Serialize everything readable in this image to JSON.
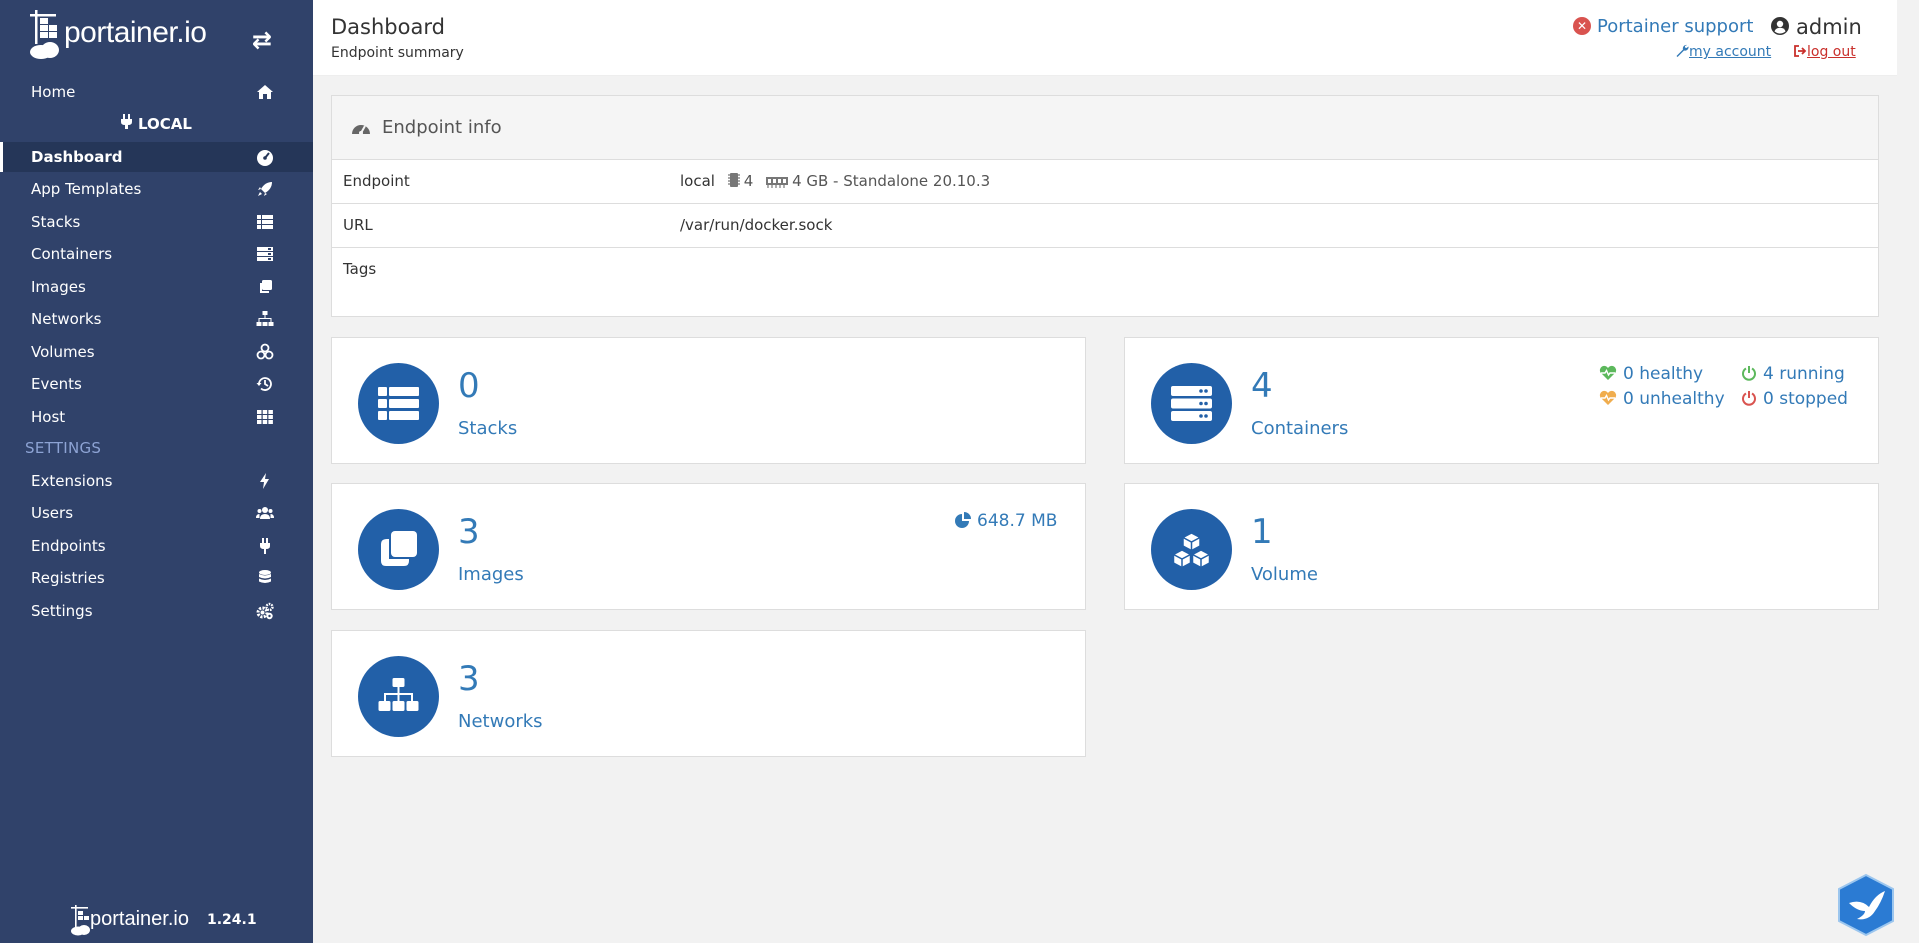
{
  "brand": {
    "logo_text": "portainer.io",
    "toggle_icon": "exchange-icon"
  },
  "sidebar": {
    "home": "Home",
    "endpoint_heading": "LOCAL",
    "items": [
      {
        "label": "Dashboard",
        "icon": "tachometer-icon",
        "active": true
      },
      {
        "label": "App Templates",
        "icon": "rocket-icon"
      },
      {
        "label": "Stacks",
        "icon": "th-list-icon"
      },
      {
        "label": "Containers",
        "icon": "server-icon"
      },
      {
        "label": "Images",
        "icon": "clone-icon"
      },
      {
        "label": "Networks",
        "icon": "sitemap-icon"
      },
      {
        "label": "Volumes",
        "icon": "cubes-icon"
      },
      {
        "label": "Events",
        "icon": "history-icon"
      },
      {
        "label": "Host",
        "icon": "th-icon"
      }
    ],
    "settings_heading": "SETTINGS",
    "settings_items": [
      {
        "label": "Extensions",
        "icon": "bolt-icon"
      },
      {
        "label": "Users",
        "icon": "users-icon"
      },
      {
        "label": "Endpoints",
        "icon": "plug-icon"
      },
      {
        "label": "Registries",
        "icon": "database-icon"
      },
      {
        "label": "Settings",
        "icon": "cogs-icon"
      }
    ],
    "footer": {
      "logo_text": "portainer.io",
      "version": "1.24.1"
    }
  },
  "header": {
    "title": "Dashboard",
    "subtitle": "Endpoint summary",
    "support": "Portainer support",
    "user": "admin",
    "my_account": "my account",
    "log_out": "log out"
  },
  "endpoint_info": {
    "title": "Endpoint info",
    "rows": {
      "endpoint_label": "Endpoint",
      "endpoint_name": "local",
      "cpu": "4",
      "memory": "4 GB - Standalone 20.10.3",
      "url_label": "URL",
      "url_value": "/var/run/docker.sock",
      "tags_label": "Tags"
    }
  },
  "tiles": {
    "stacks": {
      "count": "0",
      "label": "Stacks"
    },
    "containers": {
      "count": "4",
      "label": "Containers",
      "healthy": "0 healthy",
      "running": "4 running",
      "unhealthy": "0 unhealthy",
      "stopped": "0 stopped"
    },
    "images": {
      "count": "3",
      "label": "Images",
      "size": "648.7 MB"
    },
    "volumes": {
      "count": "1",
      "label": "Volume"
    },
    "networks": {
      "count": "3",
      "label": "Networks"
    }
  },
  "colors": {
    "sidebar_bg": "#30426a",
    "tile_circle": "#2260a8",
    "link": "#337ab7",
    "healthy": "#5cb85c",
    "unhealthy": "#f0ad4e",
    "stopped": "#d9534f"
  }
}
